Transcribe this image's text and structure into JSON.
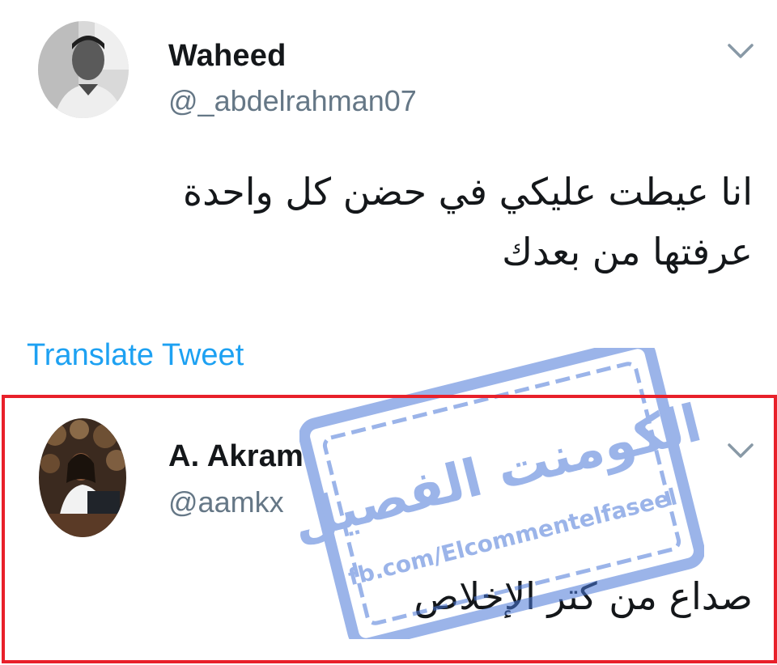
{
  "tweet1": {
    "display_name": "Waheed",
    "handle": "@_abdelrahman07",
    "text_line1": "انا عيطت عليكي في حضن كل واحدة",
    "text_line2": "عرفتها من بعدك",
    "translate_label": "Translate Tweet",
    "menu_icon": "chevron-down-icon",
    "avatar_icon": "avatar"
  },
  "tweet2": {
    "display_name": "A. Akram",
    "handle": "@aamkx",
    "text": "صداع من كتر الإخلاص",
    "menu_icon": "chevron-down-icon",
    "avatar_icon": "avatar"
  },
  "watermark": {
    "arabic": "الكومنت الفصيل",
    "url": "fb.com/Elcommentelfaseel",
    "color": "#4a78d8"
  },
  "colors": {
    "link": "#1da1f2",
    "handle": "#657786",
    "text": "#14171a",
    "highlight": "#e8202a"
  }
}
